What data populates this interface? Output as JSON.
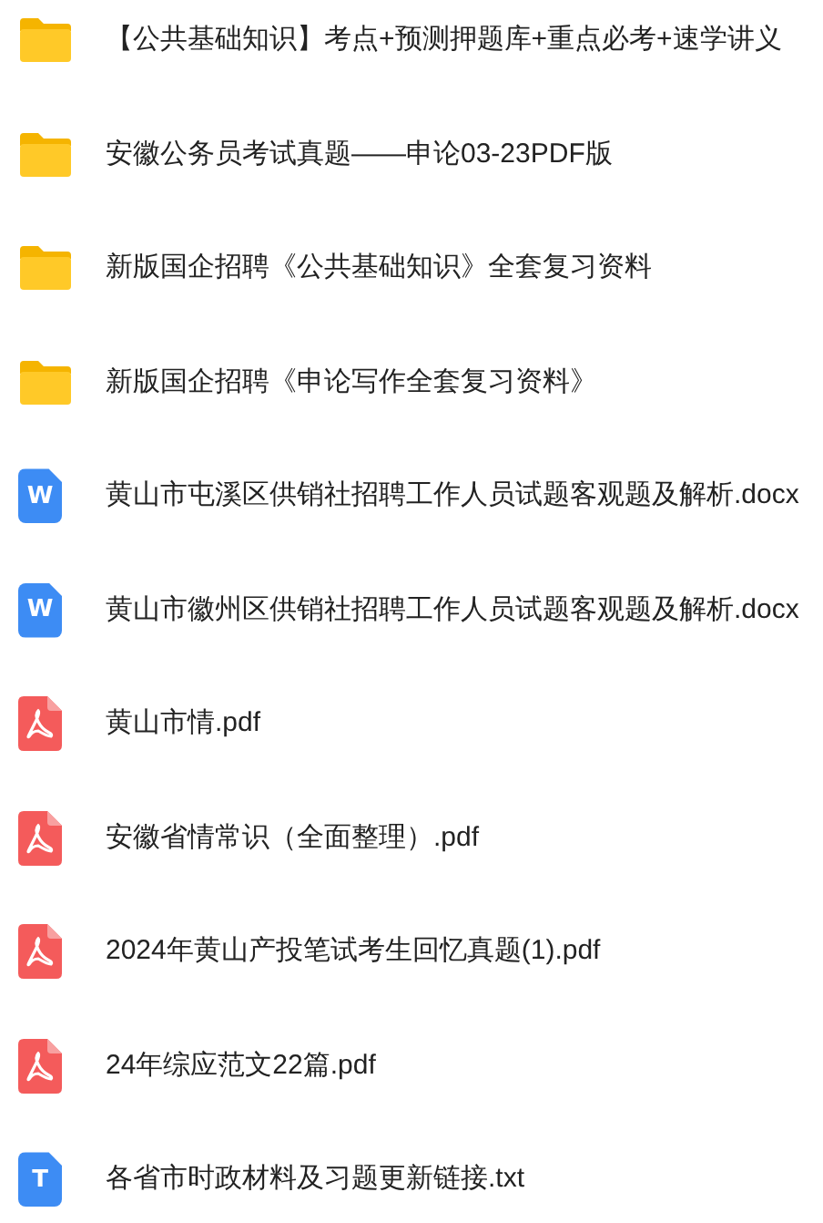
{
  "files": [
    {
      "kind": "folder",
      "name": "【公共基础知识】考点+预测押题库+重点必考+速学讲义"
    },
    {
      "kind": "folder",
      "name": "安徽公务员考试真题——申论03-23PDF版"
    },
    {
      "kind": "folder",
      "name": "新版国企招聘《公共基础知识》全套复习资料"
    },
    {
      "kind": "folder",
      "name": "新版国企招聘《申论写作全套复习资料》"
    },
    {
      "kind": "word",
      "icon_letter": "W",
      "name": "黄山市屯溪区供销社招聘工作人员试题客观题及解析.docx"
    },
    {
      "kind": "word",
      "icon_letter": "W",
      "name": "黄山市徽州区供销社招聘工作人员试题客观题及解析.docx"
    },
    {
      "kind": "pdf",
      "name": "黄山市情.pdf"
    },
    {
      "kind": "pdf",
      "name": "安徽省情常识（全面整理）.pdf"
    },
    {
      "kind": "pdf",
      "name": "2024年黄山产投笔试考生回忆真题(1).pdf"
    },
    {
      "kind": "pdf",
      "name": "24年综应范文22篇.pdf"
    },
    {
      "kind": "text",
      "icon_letter": "T",
      "name": "各省市时政材料及习题更新链接.txt"
    }
  ]
}
